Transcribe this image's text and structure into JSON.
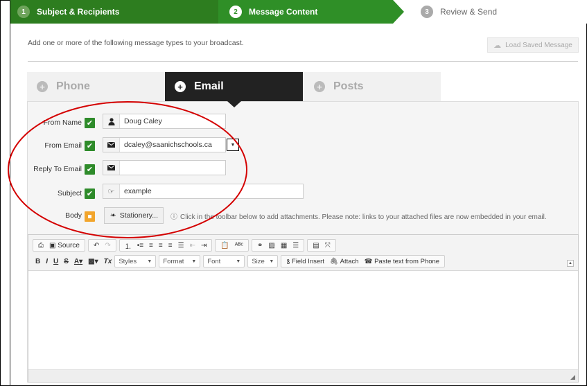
{
  "steps": [
    {
      "num": "1",
      "label": "Subject & Recipients"
    },
    {
      "num": "2",
      "label": "Message Content"
    },
    {
      "num": "3",
      "label": "Review & Send"
    }
  ],
  "intro": {
    "text": "Add one or more of the following message types to your broadcast.",
    "load_saved_label": "Load Saved Message",
    "load_saved_icon": "cloud-download-icon"
  },
  "tabs": [
    {
      "label": "Phone",
      "icon": "plus-circle-icon",
      "active": false
    },
    {
      "label": "Email",
      "icon": "plus-circle-icon",
      "active": true
    },
    {
      "label": "Posts",
      "icon": "plus-circle-icon",
      "active": false
    }
  ],
  "form": {
    "from_name": {
      "label": "From Name",
      "value": "Doug Caley",
      "icon": "user-icon",
      "status": "check"
    },
    "from_email": {
      "label": "From Email",
      "value": "dcaley@saanichschools.ca",
      "icon": "envelope-icon",
      "status": "check"
    },
    "reply_to": {
      "label": "Reply To Email",
      "value": "",
      "icon": "envelope-icon",
      "status": "check"
    },
    "subject": {
      "label": "Subject",
      "value": "example",
      "icon": "hand-point-icon",
      "status": "check"
    },
    "body": {
      "label": "Body",
      "status": "pending",
      "stationery_label": "Stationery...",
      "note": "Click  in the toolbar below to add attachments. Please note: links to your attached files are now embedded in your email."
    }
  },
  "toolbar": {
    "source_label": "Source",
    "styles": "Styles",
    "format": "Format",
    "font": "Font",
    "size": "Size",
    "field_insert": "Field Insert",
    "attach": "Attach",
    "paste_phone": "Paste text from Phone"
  },
  "colors": {
    "step_done": "#2d7d1f",
    "step_active": "#2f8f27",
    "tab_active": "#222222",
    "check_green": "#2e8b2a",
    "pending_orange": "#f2a52c",
    "annotation_red": "#d40000"
  }
}
